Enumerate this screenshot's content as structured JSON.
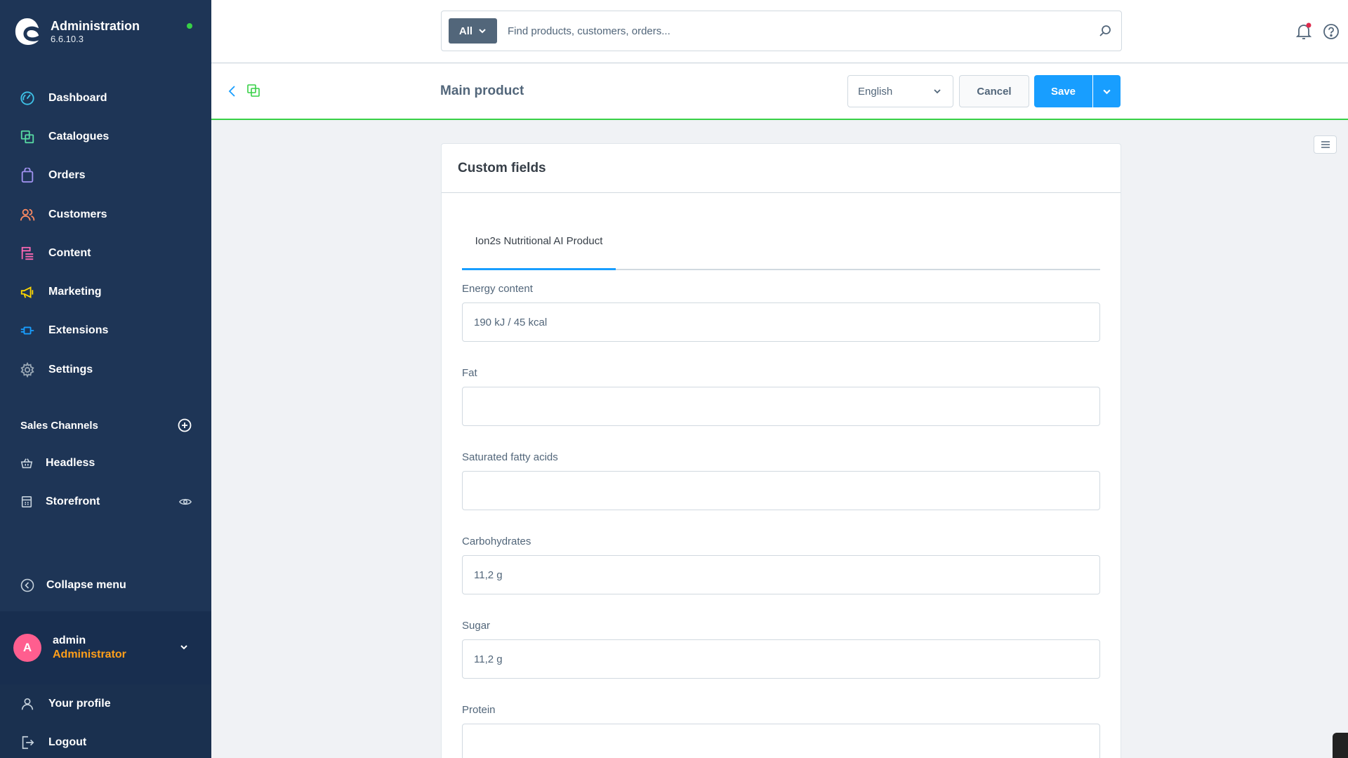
{
  "app": {
    "title": "Administration",
    "version": "6.6.10.3",
    "colors": {
      "sidebar": "#1e3556",
      "accent": "#189eff",
      "online": "#37d046",
      "role": "#ff9f1a"
    }
  },
  "nav": {
    "items": [
      {
        "label": "Dashboard",
        "icon": "dashboard-icon"
      },
      {
        "label": "Catalogues",
        "icon": "catalogues-icon"
      },
      {
        "label": "Orders",
        "icon": "orders-icon"
      },
      {
        "label": "Customers",
        "icon": "customers-icon"
      },
      {
        "label": "Content",
        "icon": "content-icon"
      },
      {
        "label": "Marketing",
        "icon": "marketing-icon"
      },
      {
        "label": "Extensions",
        "icon": "extensions-icon"
      },
      {
        "label": "Settings",
        "icon": "settings-icon"
      }
    ]
  },
  "sales_channels": {
    "title": "Sales Channels",
    "items": [
      {
        "label": "Headless",
        "icon": "basket-icon"
      },
      {
        "label": "Storefront",
        "icon": "storefront-icon"
      }
    ]
  },
  "collapse_label": "Collapse menu",
  "user": {
    "initial": "A",
    "name": "admin",
    "role": "Administrator"
  },
  "user_menu": {
    "profile": "Your profile",
    "logout": "Logout"
  },
  "search": {
    "type": "All",
    "placeholder": "Find products, customers, orders..."
  },
  "smartbar": {
    "title": "Main product",
    "language": "English",
    "cancel": "Cancel",
    "save": "Save"
  },
  "card": {
    "title": "Custom fields",
    "tab": "Ion2s Nutritional AI Product",
    "fields": [
      {
        "label": "Energy content",
        "value": "190 kJ / 45 kcal"
      },
      {
        "label": "Fat",
        "value": ""
      },
      {
        "label": "Saturated fatty acids",
        "value": ""
      },
      {
        "label": "Carbohydrates",
        "value": "11,2 g"
      },
      {
        "label": "Sugar",
        "value": "11,2 g"
      },
      {
        "label": "Protein",
        "value": ""
      }
    ]
  }
}
